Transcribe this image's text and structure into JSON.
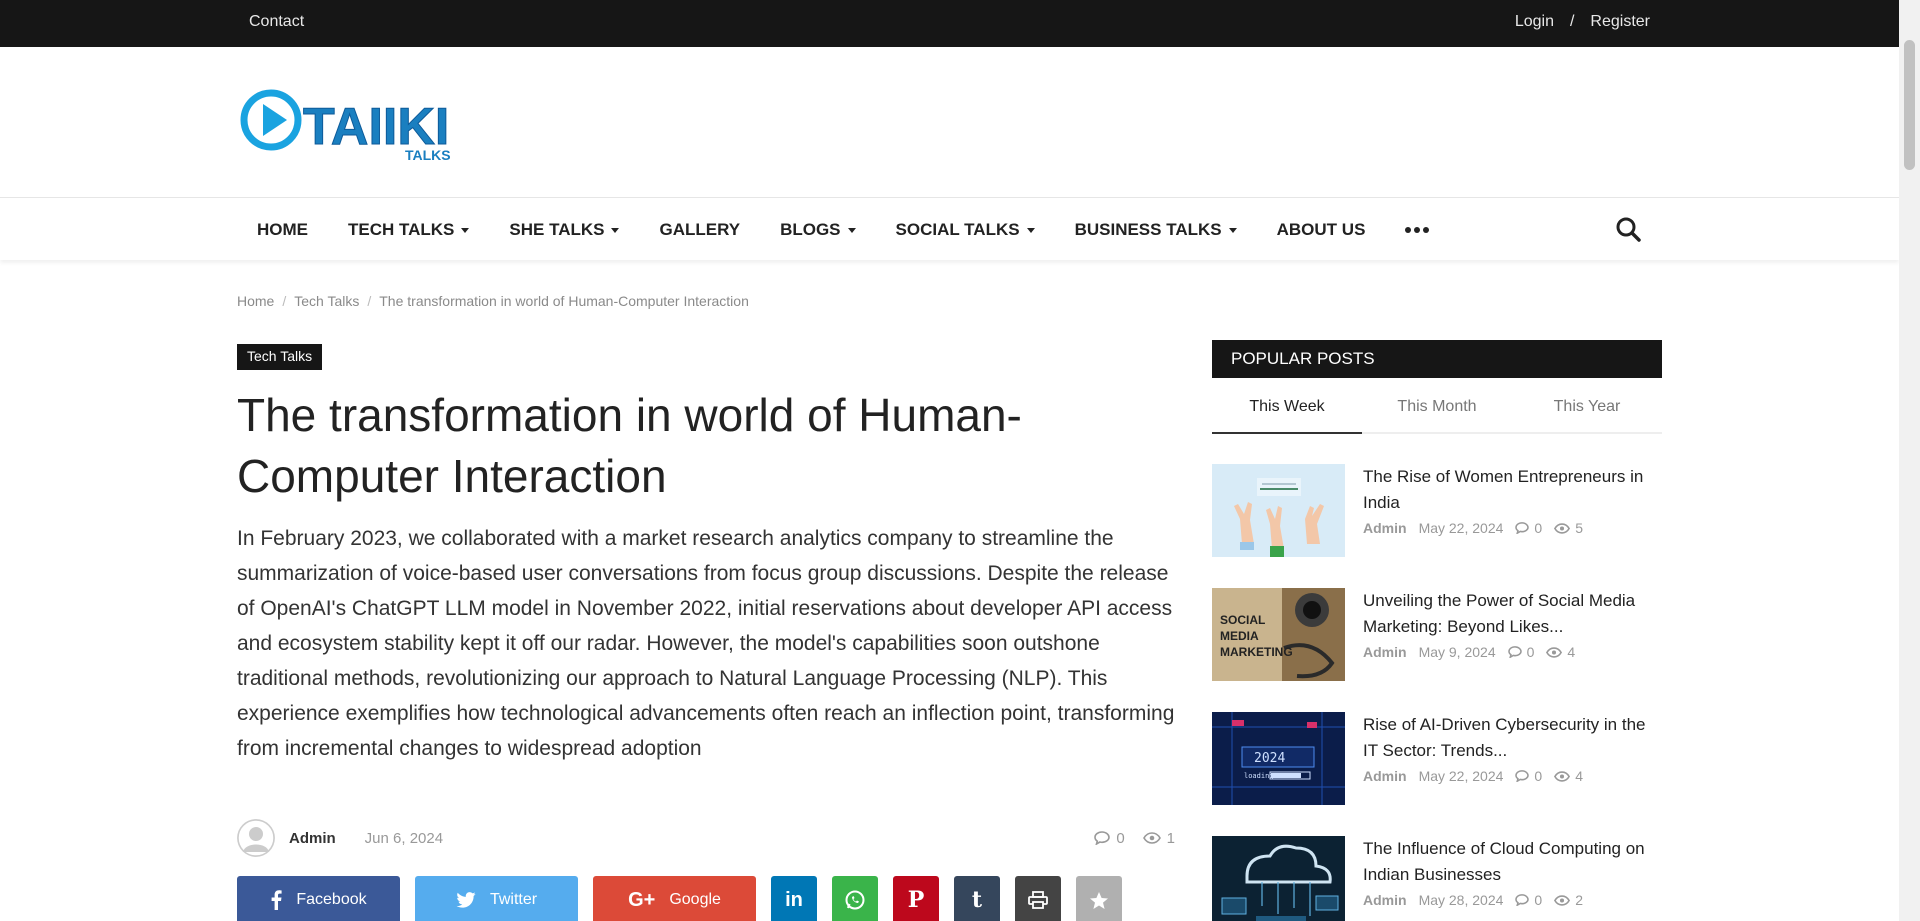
{
  "topbar": {
    "contact": "Contact",
    "login": "Login",
    "sep": "/",
    "register": "Register"
  },
  "brand": {
    "logo_text": "TAIIKI",
    "logo_sub": "TALKS",
    "accent": "#1aa3e0"
  },
  "nav": {
    "items": [
      {
        "label": "HOME",
        "dropdown": false
      },
      {
        "label": "TECH TALKS",
        "dropdown": true
      },
      {
        "label": "SHE TALKS",
        "dropdown": true
      },
      {
        "label": "GALLERY",
        "dropdown": false
      },
      {
        "label": "BLOGS",
        "dropdown": true
      },
      {
        "label": "SOCIAL TALKS",
        "dropdown": true
      },
      {
        "label": "BUSINESS TALKS",
        "dropdown": true
      },
      {
        "label": "ABOUT US",
        "dropdown": false
      }
    ]
  },
  "breadcrumb": {
    "home": "Home",
    "category": "Tech Talks",
    "current": "The transformation in world of Human-Computer Interaction"
  },
  "article": {
    "category": "Tech Talks",
    "title": "The transformation in world of Human-Computer Interaction",
    "summary": "In February 2023, we collaborated with a market research analytics company to streamline the summarization of voice-based user conversations from focus group discussions. Despite the release of OpenAI's ChatGPT LLM model in November 2022, initial reservations about developer API access and ecosystem stability kept it off our radar. However, the model's capabilities soon outshone traditional methods, revolutionizing our approach to Natural Language Processing (NLP). This experience exemplifies how technological advancements often reach an inflection point, transforming from incremental changes to widespread adoption",
    "author": "Admin",
    "date": "Jun 6, 2024",
    "comments": "0",
    "views": "1"
  },
  "share": {
    "facebook": "Facebook",
    "twitter": "Twitter",
    "google": "Google",
    "colors": {
      "facebook": "#3b5998",
      "twitter": "#55acee",
      "google": "#dc4a38",
      "linkedin": "#0077b5",
      "whatsapp": "#3ab44a",
      "pinterest": "#bd081c",
      "tumblr": "#35465c",
      "print": "#444444",
      "favorite": "#b0b0b0"
    }
  },
  "sidebar": {
    "heading": "POPULAR POSTS",
    "tabs": [
      "This Week",
      "This Month",
      "This Year"
    ],
    "posts": [
      {
        "title": "The Rise of Women Entrepreneurs in India",
        "author": "Admin",
        "date": "May 22, 2024",
        "comments": "0",
        "views": "5",
        "thumb_text": ""
      },
      {
        "title": "Unveiling the Power of Social Media Marketing: Beyond Likes...",
        "author": "Admin",
        "date": "May 9, 2024",
        "comments": "0",
        "views": "4",
        "thumb_text": "SOCIAL MEDIA MARKETING"
      },
      {
        "title": "Rise of AI-Driven Cybersecurity in the IT Sector: Trends...",
        "author": "Admin",
        "date": "May 22, 2024",
        "comments": "0",
        "views": "4",
        "thumb_text": "2024 loading"
      },
      {
        "title": "The Influence of Cloud Computing on Indian Businesses",
        "author": "Admin",
        "date": "May 28, 2024",
        "comments": "0",
        "views": "2",
        "thumb_text": ""
      }
    ]
  }
}
